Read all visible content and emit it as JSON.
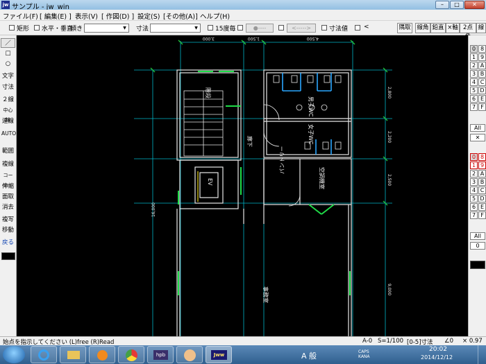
{
  "window": {
    "title": "サンプル - jw_win",
    "icon": "jw"
  },
  "menu": [
    "ファイル(F)",
    "[ 編集(E) ]",
    "表示(V)",
    "[ 作図(D) ]",
    "設定(S)",
    "[その他(A)]",
    "ヘルプ(H)"
  ],
  "toolbar": {
    "rect_label": "矩形",
    "hv_label": "水平・垂直",
    "slope_label": "傾き",
    "slope_value": "",
    "dim_label": "寸法",
    "dim_value": "",
    "deg15_label": "15度毎",
    "field1": "●----",
    "field2": "<----->",
    "dimval_label": "寸法値",
    "lt_label": "<",
    "right_buttons": [
      "隅取",
      "線角",
      "鉛直",
      "×軸",
      "2点角",
      "線"
    ]
  },
  "left_tools": [
    "／",
    "□",
    "○",
    "文字",
    "寸法",
    "２線",
    "中心線",
    "連線",
    "AUTO",
    "範囲",
    "複線",
    "コーナー",
    "伸縮",
    "面取",
    "消去",
    "複写",
    "移動",
    "戻る"
  ],
  "right_layers_top": [
    "0",
    "8",
    "1",
    "9",
    "2",
    "A",
    "3",
    "B",
    "4",
    "C",
    "5",
    "D",
    "6",
    "E",
    "7",
    "F"
  ],
  "right_layers_top_all": "All",
  "right_layers_bottom": [
    "0",
    "8",
    "1",
    "9",
    "2",
    "A",
    "3",
    "B",
    "4",
    "C",
    "5",
    "D",
    "6",
    "E",
    "7",
    "F"
  ],
  "right_layers_bottom_all": "All",
  "right_layers_bottom_zero": "0",
  "drawing": {
    "top_dims": [
      "3,000",
      "1,500",
      "4,500"
    ],
    "right_dims": [
      "2,800",
      "2,200",
      "2,500",
      "9,000"
    ],
    "left_dim": "16,000",
    "room_stair": "階段",
    "room_mwc": "男子WC",
    "room_wwc": "女子WC",
    "room_ev": "EV",
    "room_pantry": "パントリー",
    "room_ac": "空調機室",
    "room_corridor": "廊下",
    "room_office": "事務室"
  },
  "status": {
    "message": "始点を指示してください (L)free (R)Read",
    "layer": "A-0",
    "scale": "S=1/100",
    "mode": "[0-5]寸法",
    "angle": "∠0",
    "zoom": "× 0.97"
  },
  "taskbar": {
    "apps": [
      "start",
      "ie",
      "explorer",
      "media",
      "chrome",
      "hpb",
      "app-character",
      "jww"
    ],
    "ime_text": "A 般",
    "caps_text": "CAPS KANA",
    "time": "20:02",
    "date": "2014/12/12"
  }
}
